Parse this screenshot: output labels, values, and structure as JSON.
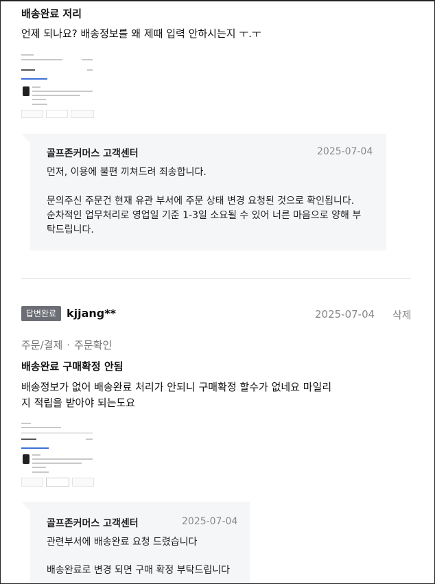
{
  "review1": {
    "title": "배송완료 저리",
    "text": "언제 되나요? 배송정보를 왜 제때 입력 안하시는지 ㅜ.ㅜ",
    "reply": {
      "name": "골프존커머스 고객센터",
      "date": "2025-07-04",
      "lines": [
        "먼저, 이용에 불편 끼쳐드려 죄송합니다.",
        "",
        "문의주신 주문건 현재 유관 부서에 주문 상태 변경 요청된 것으로 확인됩니다.",
        "순차적인 업무처리로 영업일 기준 1-3일 소요될 수 있어 너른 마음으로 양해 부",
        "탁드립니다."
      ]
    }
  },
  "review2": {
    "badge": "답변완료",
    "user": "kjjang**",
    "date": "2025-07-04",
    "delete_label": "삭제",
    "category_main": "주문/결제",
    "category_sep": "·",
    "category_sub": "주문확인",
    "title": "배송완료 구매확정 안됨",
    "text_line1": "배송정보가 없어 배송완료 처리가 안되니 구매확정 할수가 없네요 마일리",
    "text_line2": "지 적립을 받아야 되는도요",
    "reply": {
      "name": "골프존커머스 고객센터",
      "date": "2025-07-04",
      "lines": [
        "관련부서에 배송완료 요청 드렸습니다",
        "",
        "배송완료로 변경 되면 구매 확정 부탁드립니다"
      ]
    }
  }
}
